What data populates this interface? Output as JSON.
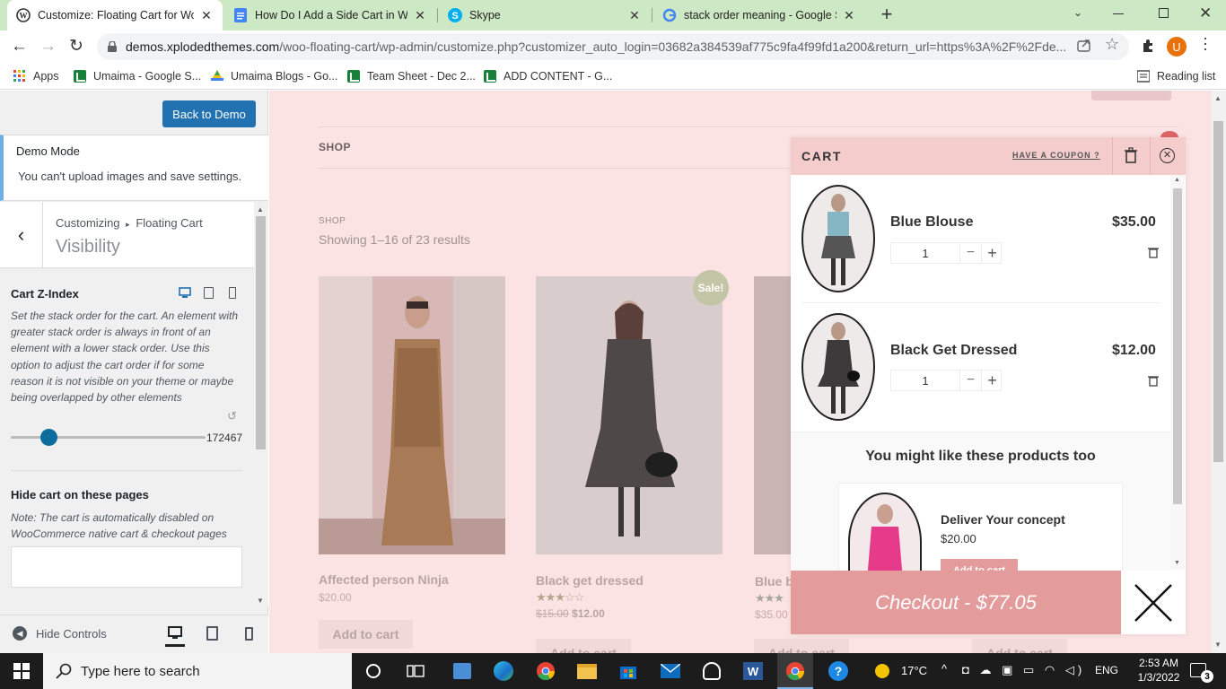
{
  "browser": {
    "tabs": [
      {
        "title": "Customize: Floating Cart for Woo"
      },
      {
        "title": "How Do I Add a Side Cart in Woo"
      },
      {
        "title": "Skype"
      },
      {
        "title": "stack order meaning - Google Se"
      }
    ],
    "url_host": "demos.xplodedthemes.com",
    "url_path": "/woo-floating-cart/wp-admin/customize.php?customizer_auto_login=03682a384539af775c9fa4f99fd1a200&return_url=https%3A%2F%2Fde...",
    "profile_letter": "U",
    "bookmarks": [
      "Apps",
      "Umaima - Google S...",
      "Umaima Blogs - Go...",
      "Team Sheet - Dec 2...",
      "ADD CONTENT - G..."
    ],
    "reading_list": "Reading list"
  },
  "customizer": {
    "back_to_demo": "Back to Demo",
    "demo_title": "Demo Mode",
    "demo_text": "You can't upload images and save settings.",
    "crumb_root": "Customizing",
    "crumb_arrow": "▸",
    "crumb_section": "Floating Cart",
    "section_title": "Visibility",
    "zindex_title": "Cart Z-Index",
    "zindex_desc": "Set the stack order for the cart. An element with greater stack order is always in front of an element with a lower stack order. Use this option to adjust the cart order if for some reason it is not visible on your theme or maybe being overlapped by other elements",
    "zindex_value": "172467",
    "hide_title": "Hide cart on these pages",
    "hide_note": "Note: The cart is automatically disabled on WooCommerce native cart & checkout pages",
    "hide_controls": "Hide Controls"
  },
  "site": {
    "menu_shop": "SHOP",
    "breadcrumb": "SHOP",
    "result_count": "Showing 1–16 of 23 results",
    "sale_badge": "Sale!",
    "products": [
      {
        "title": "Affected person Ninja",
        "price": "$20.00",
        "button": "Add to cart"
      },
      {
        "title": "Black get dressed",
        "old_price": "$15.00",
        "price": "$12.00",
        "rating": 3,
        "button": "Add to cart"
      },
      {
        "title": "Blue b",
        "price": "$35.00",
        "rating": 5,
        "button": "Add to cart"
      },
      {
        "button": "Add to cart"
      }
    ]
  },
  "cart": {
    "title": "CART",
    "coupon": "HAVE A COUPON ?",
    "items": [
      {
        "name": "Blue Blouse",
        "price": "$35.00",
        "qty": "1"
      },
      {
        "name": "Black Get Dressed",
        "price": "$12.00",
        "qty": "1"
      }
    ],
    "upsell_title": "You might like these products too",
    "upsell": {
      "name": "Deliver Your concept",
      "price": "$20.00",
      "button": "Add to cart"
    },
    "checkout": "Checkout - $77.05"
  },
  "taskbar": {
    "search_placeholder": "Type here to search",
    "temperature": "17°C",
    "language": "ENG",
    "time": "2:53 AM",
    "date": "1/3/2022",
    "notifications": "3"
  },
  "colors": {
    "accent": "#2271b1",
    "cart_header": "#f4cccc",
    "checkout": "#e39b9b",
    "site_bg": "#fbe3e3"
  }
}
